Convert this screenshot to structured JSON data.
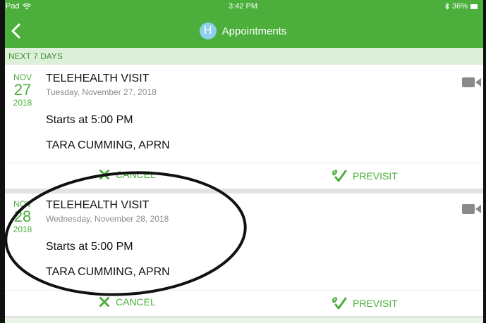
{
  "status_bar": {
    "device": "Pad",
    "time": "3:42 PM",
    "battery": "36%"
  },
  "nav": {
    "avatar_letter": "H",
    "title": "Appointments",
    "back_icon": "chevron-left-icon"
  },
  "section": {
    "header": "NEXT 7 DAYS"
  },
  "appointments": [
    {
      "month": "NOV",
      "day": "27",
      "year": "2018",
      "title": "TELEHEALTH VISIT",
      "date_full": "Tuesday, November 27, 2018",
      "time": "Starts at 5:00 PM",
      "provider": "TARA CUMMING, APRN",
      "cancel_label": "CANCEL",
      "previsit_label": "PREVISIT",
      "type_icon": "video-camera-icon"
    },
    {
      "month": "NOV",
      "day": "28",
      "year": "2018",
      "title": "TELEHEALTH VISIT",
      "date_full": "Wednesday, November 28, 2018",
      "time": "Starts at 5:00 PM",
      "provider": "TARA CUMMING, APRN",
      "cancel_label": "CANCEL",
      "previsit_label": "PREVISIT",
      "type_icon": "video-camera-icon"
    }
  ],
  "colors": {
    "brand_green": "#4caf3c",
    "section_bg": "#dff0da",
    "avatar_blue": "#8fd0ee",
    "icon_gray": "#8a8a8a"
  }
}
